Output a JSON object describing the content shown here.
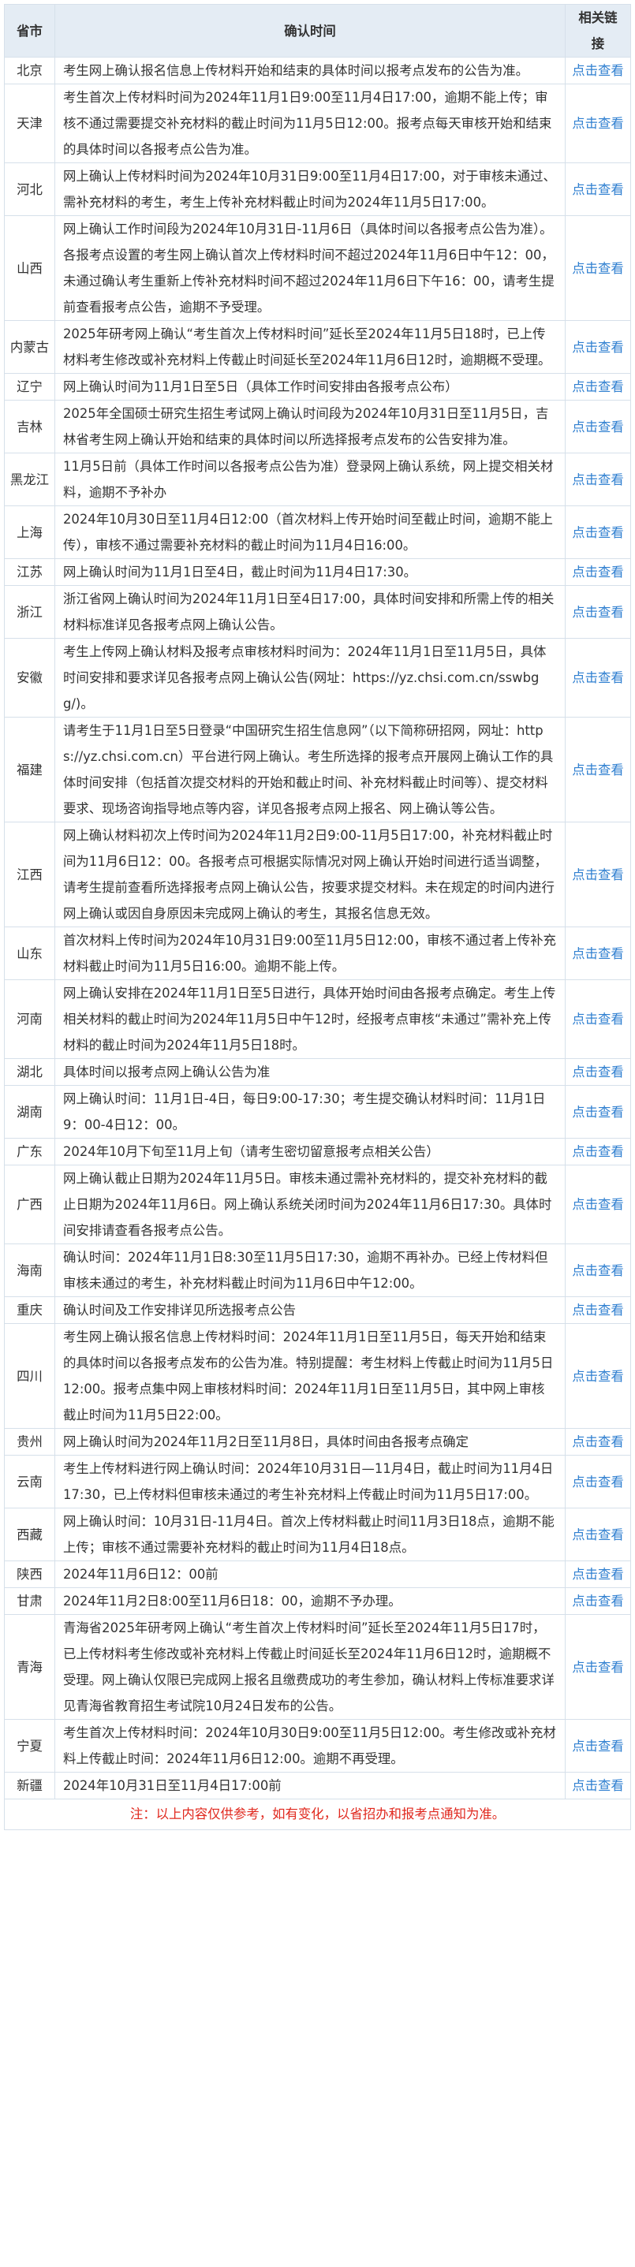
{
  "table": {
    "headers": [
      "省市",
      "确认时间",
      "相关链接"
    ],
    "link_label": "点击查看",
    "rows": [
      {
        "province": "北京",
        "text": "考生网上确认报名信息上传材料开始和结束的具体时间以报考点发布的公告为准。"
      },
      {
        "province": "天津",
        "text": "考生首次上传材料时间为2024年11月1日9:00至11月4日17:00，逾期不能上传；审核不通过需要提交补充材料的截止时间为11月5日12:00。报考点每天审核开始和结束的具体时间以各报考点公告为准。"
      },
      {
        "province": "河北",
        "text": "网上确认上传材料时间为2024年10月31日9:00至11月4日17:00，对于审核未通过、需补充材料的考生，考生上传补充材料截止时间为2024年11月5日17:00。"
      },
      {
        "province": "山西",
        "text": "网上确认工作时间段为2024年10月31日-11月6日（具体时间以各报考点公告为准）。各报考点设置的考生网上确认首次上传材料时间不超过2024年11月6日中午12：00，未通过确认考生重新上传补充材料时间不超过2024年11月6日下午16：00，请考生提前查看报考点公告，逾期不予受理。"
      },
      {
        "province": "内蒙古",
        "text": "2025年研考网上确认“考生首次上传材料时间”延长至2024年11月5日18时，已上传材料考生修改或补充材料上传截止时间延长至2024年11月6日12时，逾期概不受理。"
      },
      {
        "province": "辽宁",
        "text": "网上确认时间为11月1日至5日（具体工作时间安排由各报考点公布）"
      },
      {
        "province": "吉林",
        "text": "2025年全国硕士研究生招生考试网上确认时间段为2024年10月31日至11月5日，吉林省考生网上确认开始和结束的具体时间以所选择报考点发布的公告安排为准。"
      },
      {
        "province": "黑龙江",
        "text": "11月5日前（具体工作时间以各报考点公告为准）登录网上确认系统，网上提交相关材料，逾期不予补办"
      },
      {
        "province": "上海",
        "text": "2024年10月30日至11月4日12:00（首次材料上传开始时间至截止时间，逾期不能上传），审核不通过需要补充材料的截止时间为11月4日16:00。"
      },
      {
        "province": "江苏",
        "text": "网上确认时间为11月1日至4日，截止时间为11月4日17:30。"
      },
      {
        "province": "浙江",
        "text": "浙江省网上确认时间为2024年11月1日至4日17:00，具体时间安排和所需上传的相关材料标准详见各报考点网上确认公告。"
      },
      {
        "province": "安徽",
        "text": "考生上传网上确认材料及报考点审核材料时间为：2024年11月1日至11月5日，具体时间安排和要求详见各报考点网上确认公告(网址：https://yz.chsi.com.cn/sswbgg/)。"
      },
      {
        "province": "福建",
        "text": "请考生于11月1日至5日登录“中国研究生招生信息网”（以下简称研招网，网址：https://yz.chsi.com.cn）平台进行网上确认。考生所选择的报考点开展网上确认工作的具体时间安排（包括首次提交材料的开始和截止时间、补充材料截止时间等）、提交材料要求、现场咨询指导地点等内容，详见各报考点网上报名、网上确认等公告。"
      },
      {
        "province": "江西",
        "text": "网上确认材料初次上传时间为2024年11月2日9:00-11月5日17:00，补充材料截止时间为11月6日12：00。各报考点可根据实际情况对网上确认开始时间进行适当调整，请考生提前查看所选择报考点网上确认公告，按要求提交材料。未在规定的时间内进行网上确认或因自身原因未完成网上确认的考生，其报名信息无效。"
      },
      {
        "province": "山东",
        "text": "首次材料上传时间为2024年10月31日9:00至11月5日12:00，审核不通过者上传补充材料截止时间为11月5日16:00。逾期不能上传。"
      },
      {
        "province": "河南",
        "text": "网上确认安排在2024年11月1日至5日进行，具体开始时间由各报考点确定。考生上传相关材料的截止时间为2024年11月5日中午12时，经报考点审核“未通过”需补充上传材料的截止时间为2024年11月5日18时。"
      },
      {
        "province": "湖北",
        "text": "具体时间以报考点网上确认公告为准"
      },
      {
        "province": "湖南",
        "text": "网上确认时间：11月1日-4日，每日9:00-17:30；考生提交确认材料时间：11月1日9：00-4日12：00。"
      },
      {
        "province": "广东",
        "text": "2024年10月下旬至11月上旬（请考生密切留意报考点相关公告）"
      },
      {
        "province": "广西",
        "text": "网上确认截止日期为2024年11月5日。审核未通过需补充材料的，提交补充材料的截止日期为2024年11月6日。网上确认系统关闭时间为2024年11月6日17:30。具体时间安排请查看各报考点公告。"
      },
      {
        "province": "海南",
        "text": "确认时间：2024年11月1日8:30至11月5日17:30，逾期不再补办。已经上传材料但审核未通过的考生，补充材料截止时间为11月6日中午12:00。"
      },
      {
        "province": "重庆",
        "text": "确认时间及工作安排详见所选报考点公告"
      },
      {
        "province": "四川",
        "text": "考生网上确认报名信息上传材料时间：2024年11月1日至11月5日，每天开始和结束的具体时间以各报考点发布的公告为准。特别提醒：考生材料上传截止时间为11月5日12:00。报考点集中网上审核材料时间：2024年11月1日至11月5日，其中网上审核截止时间为11月5日22:00。"
      },
      {
        "province": "贵州",
        "text": "网上确认时间为2024年11月2日至11月8日，具体时间由各报考点确定"
      },
      {
        "province": "云南",
        "text": "考生上传材料进行网上确认时间：2024年10月31日—11月4日，截止时间为11月4日17:30，已上传材料但审核未通过的考生补充材料上传截止时间为11月5日17:00。"
      },
      {
        "province": "西藏",
        "text": "网上确认时间：10月31日-11月4日。首次上传材料截止时间11月3日18点，逾期不能上传；审核不通过需要补充材料的截止时间为11月4日18点。"
      },
      {
        "province": "陕西",
        "text": "2024年11月6日12：00前"
      },
      {
        "province": "甘肃",
        "text": "2024年11月2日8:00至11月6日18：00，逾期不予办理。"
      },
      {
        "province": "青海",
        "text": "青海省2025年研考网上确认“考生首次上传材料时间”延长至2024年11月5日17时，已上传材料考生修改或补充材料上传截止时间延长至2024年11月6日12时，逾期概不受理。网上确认仅限已完成网上报名且缴费成功的考生参加，确认材料上传标准要求详见青海省教育招生考试院10月24日发布的公告。"
      },
      {
        "province": "宁夏",
        "text": "考生首次上传材料时间：2024年10月30日9:00至11月5日12:00。考生修改或补充材料上传截止时间：2024年11月6日12:00。逾期不再受理。"
      },
      {
        "province": "新疆",
        "text": "2024年10月31日至11月4日17:00前"
      }
    ]
  },
  "note": "注：以上内容仅供参考，如有变化，以省招办和报考点通知为准。"
}
